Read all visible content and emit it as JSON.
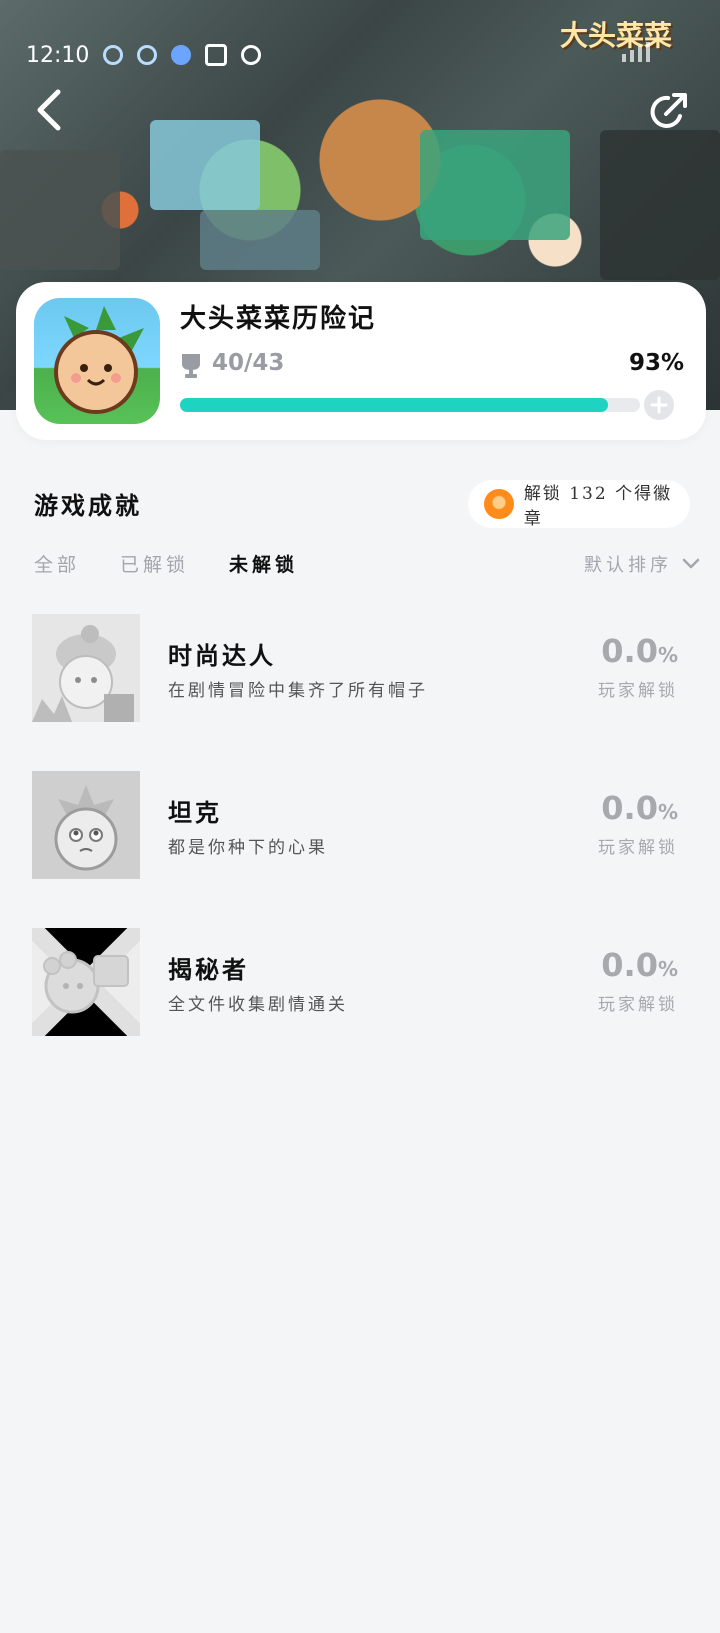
{
  "status_bar": {
    "time": "12:10"
  },
  "hero": {
    "logo_text": "大头菜菜"
  },
  "game": {
    "title": "大头菜菜历险记",
    "achievements_unlocked": 40,
    "achievements_total": 43,
    "progress_text": "40/43",
    "percent_text": "93%",
    "progress_fraction": 0.93
  },
  "section": {
    "title": "游戏成就",
    "badge_text": "解锁 132 个得徽章"
  },
  "tabs": [
    {
      "label": "全部",
      "active": false
    },
    {
      "label": "已解锁",
      "active": false
    },
    {
      "label": "未解锁",
      "active": true
    }
  ],
  "sort": {
    "label": "默认排序"
  },
  "achievements": [
    {
      "name": "时尚达人",
      "description": "在剧情冒险中集齐了所有帽子",
      "rate": "0.0",
      "rate_unit": "%",
      "rate_label": "玩家解锁"
    },
    {
      "name": "坦克",
      "description": "都是你种下的心果",
      "rate": "0.0",
      "rate_unit": "%",
      "rate_label": "玩家解锁"
    },
    {
      "name": "揭秘者",
      "description": "全文件收集剧情通关",
      "rate": "0.0",
      "rate_unit": "%",
      "rate_label": "玩家解锁"
    }
  ],
  "colors": {
    "accent": "#1fd3c3",
    "badge": "#ff8c1a",
    "background": "#f4f5f7"
  }
}
